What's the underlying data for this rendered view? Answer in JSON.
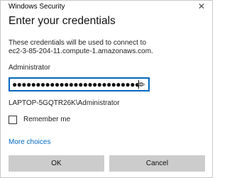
{
  "window": {
    "title": "Windows Security",
    "close_glyph": "✕"
  },
  "dialog": {
    "heading": "Enter your credentials",
    "description_line1": "These credentials will be used to connect to",
    "description_line2": "ec2-3-85-204-11.compute-1.amazonaws.com.",
    "username": "Administrator",
    "password_masked": "●●●●●●●●●●●●●●●●●●●●●●●●●●●",
    "account": "LAPTOP-5GQTR26K\\Administrator",
    "remember_label": "Remember me",
    "remember_checked": false,
    "more_choices": "More choices",
    "ok_label": "OK",
    "cancel_label": "Cancel"
  },
  "colors": {
    "accent": "#0067c0",
    "button_bg": "#cccccc"
  },
  "icons": {
    "close": "close-icon",
    "reveal_password": "eye-icon"
  }
}
